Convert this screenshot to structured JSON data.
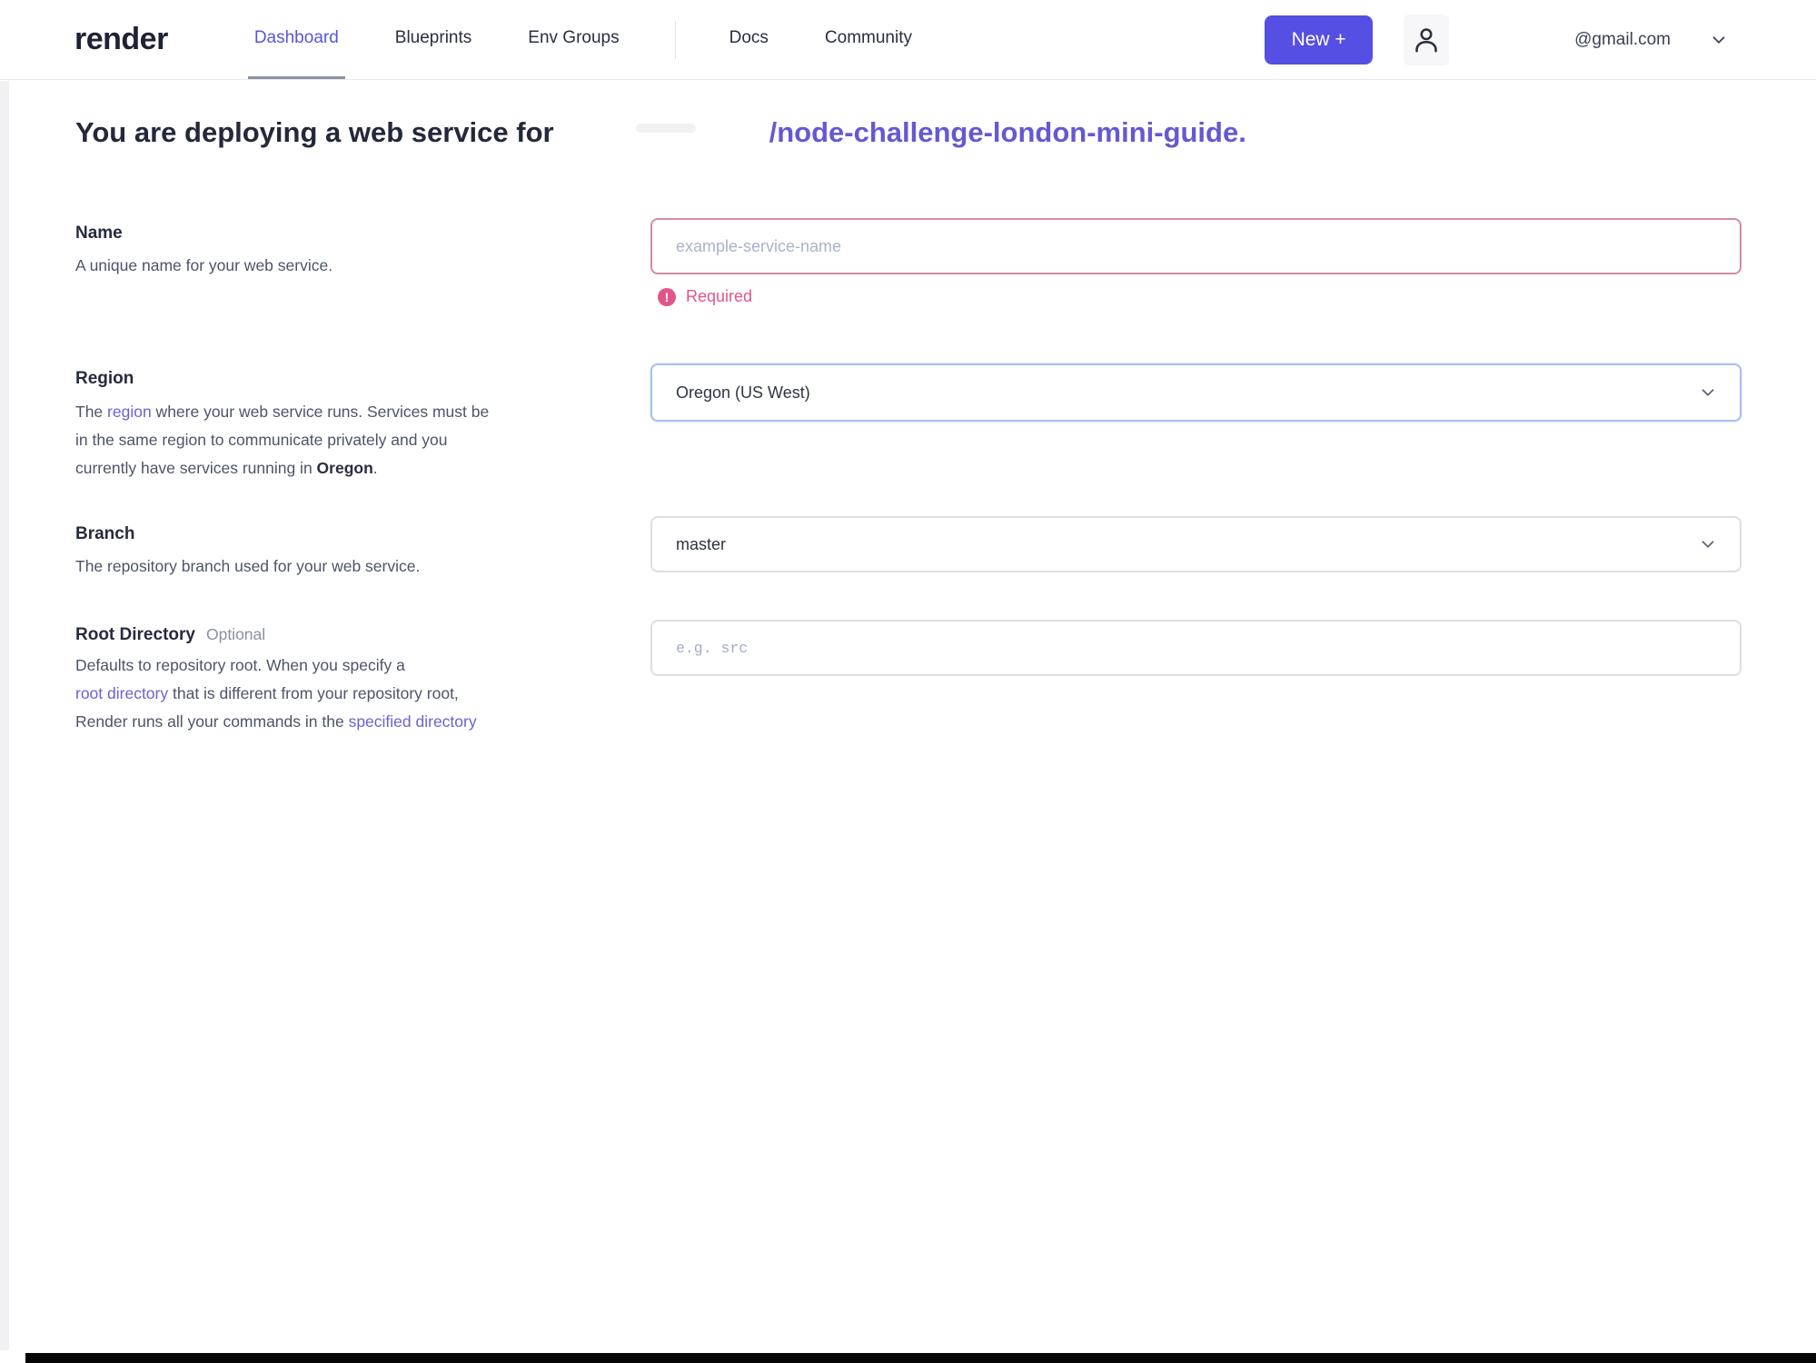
{
  "nav": {
    "logo": "render",
    "links": [
      {
        "label": "Dashboard",
        "active": true
      },
      {
        "label": "Blueprints",
        "active": false
      },
      {
        "label": "Env Groups",
        "active": false
      },
      {
        "label": "Docs",
        "active": false
      },
      {
        "label": "Community",
        "active": false
      }
    ],
    "new_button_label": "New +",
    "account_email": "@gmail.com"
  },
  "heading": {
    "prefix": "You are deploying a web service for",
    "repo_path": "/node-challenge-london-mini-guide."
  },
  "form": {
    "name_field": {
      "label": "Name",
      "description": "A unique name for your web service.",
      "value": "",
      "placeholder": "example-service-name",
      "error": "Required",
      "error_icon_glyph": "!"
    },
    "region_field": {
      "label": "Region",
      "value": "Oregon (US West)",
      "desc": {
        "s0": "The ",
        "s1": "region",
        "s2": " where your web service runs. Services must be",
        "s3": "in the same region to communicate privately and you",
        "s4": "currently have services running in ",
        "s5": "Oregon",
        "s6": "."
      }
    },
    "branch_field": {
      "label": "Branch",
      "description": "The repository branch used for your web service.",
      "value": "master"
    },
    "root_dir_field": {
      "label": "Root Directory",
      "optional_tag": "Optional",
      "value": "",
      "placeholder": "e.g. src",
      "desc": {
        "s0": "Defaults to repository root. When you specify a",
        "s1": "root directory",
        "s2": " that is different from your repository root,",
        "s3": "Render runs all your commands in the ",
        "s4": "specified directory"
      }
    }
  },
  "colors": {
    "accent_purple": "#564fe3",
    "active_link": "#5757d9",
    "repo_link": "#6459d2",
    "inline_link": "#6a62d2",
    "error_pink": "#e0568a",
    "name_input_border": "#cf8da6",
    "region_focus_border": "#a9c0ec"
  }
}
